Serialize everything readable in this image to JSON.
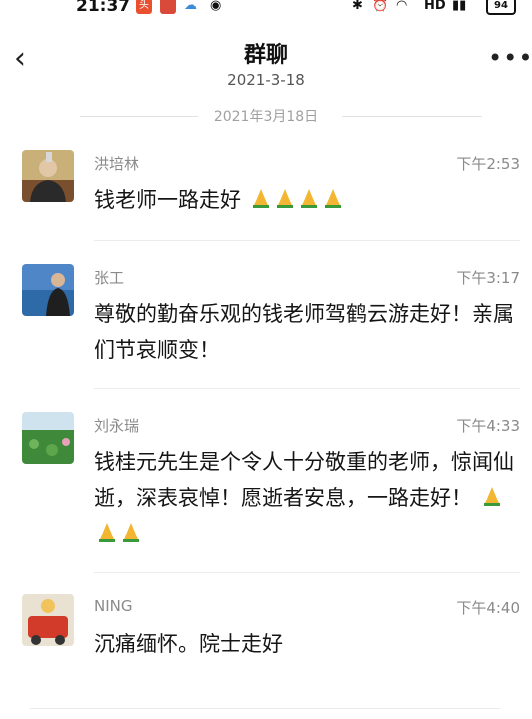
{
  "status_bar": {
    "time": "21:37",
    "app_icons": [
      "news-app-icon",
      "gallery-app-icon",
      "weather-icon",
      "weibo-icon"
    ],
    "hd_label": "HD",
    "battery": "94"
  },
  "header": {
    "title": "群聊",
    "subtitle": "2021-3-18"
  },
  "date_divider": "2021年3月18日",
  "messages": [
    {
      "sender": "洪培林",
      "time": "下午2:53",
      "text": "钱老师一路走好",
      "prayers": 4
    },
    {
      "sender": "张工",
      "time": "下午3:17",
      "text": "尊敬的勤奋乐观的钱老师驾鹤云游走好！亲属们节哀顺变！",
      "prayers": 0
    },
    {
      "sender": "刘永瑞",
      "time": "下午4:33",
      "text": "钱桂元先生是个令人十分敬重的老师，惊闻仙逝，深表哀悼！愿逝者安息，一路走好！",
      "prayers": 3
    },
    {
      "sender": "NING",
      "time": "下午4:40",
      "text": "沉痛缅怀。院士走好",
      "prayers": 0
    }
  ],
  "colors": {
    "meta_text": "#8a8a8a",
    "divider": "#ececec",
    "prayer_emoji": "#f2b632"
  }
}
